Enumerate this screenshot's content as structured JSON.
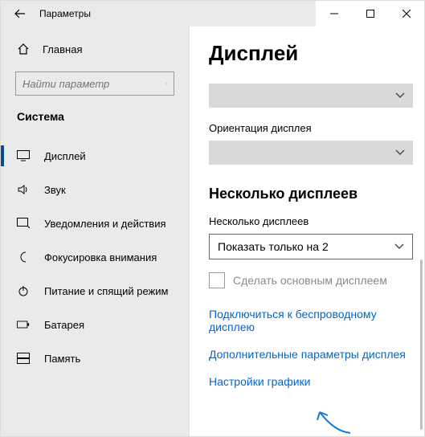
{
  "titlebar": {
    "title": "Параметры"
  },
  "sidebar": {
    "home_label": "Главная",
    "search_placeholder": "Найти параметр",
    "category": "Система",
    "items": [
      {
        "label": "Дисплей"
      },
      {
        "label": "Звук"
      },
      {
        "label": "Уведомления и действия"
      },
      {
        "label": "Фокусировка внимания"
      },
      {
        "label": "Питание и спящий режим"
      },
      {
        "label": "Батарея"
      },
      {
        "label": "Память"
      }
    ]
  },
  "content": {
    "page_title": "Дисплей",
    "orientation_label": "Ориентация дисплея",
    "multi_heading": "Несколько дисплеев",
    "multi_label": "Несколько дисплеев",
    "multi_select_value": "Показать только на 2",
    "primary_checkbox_label": "Сделать основным дисплеем",
    "links": {
      "wireless": "Подключиться к беспроводному дисплею",
      "advanced": "Дополнительные параметры дисплея",
      "graphics": "Настройки графики"
    }
  }
}
